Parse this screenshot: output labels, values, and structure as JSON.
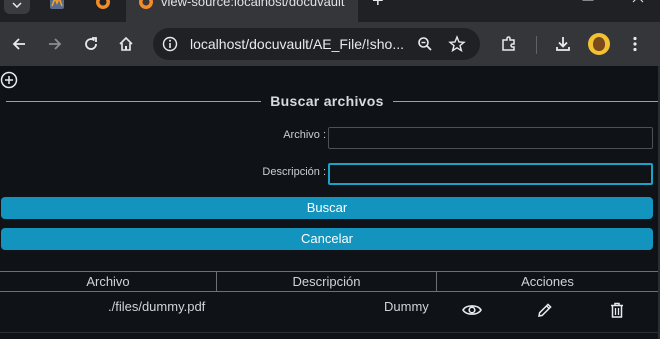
{
  "browser": {
    "active_tab_title": "view-source:localhost/docuvault",
    "url": "localhost/docuvault/AE_File/!sho..."
  },
  "form": {
    "legend": "Buscar archivos",
    "archivo_label": "Archivo :",
    "archivo_value": "",
    "descripcion_label": "Descripción :",
    "descripcion_value": "",
    "buscar_label": "Buscar",
    "cancelar_label": "Cancelar"
  },
  "table": {
    "headers": [
      "Archivo",
      "Descripción",
      "Acciones"
    ],
    "rows": [
      {
        "archivo": "./files/dummy.pdf",
        "descripcion": "Dummy"
      }
    ]
  },
  "colors": {
    "accent": "#1294be",
    "focus": "#19a3c4",
    "background": "#0f1216"
  },
  "icons": {
    "view": "eye-icon",
    "edit": "pencil-icon",
    "delete": "trash-icon",
    "add": "plus-circle-icon"
  }
}
